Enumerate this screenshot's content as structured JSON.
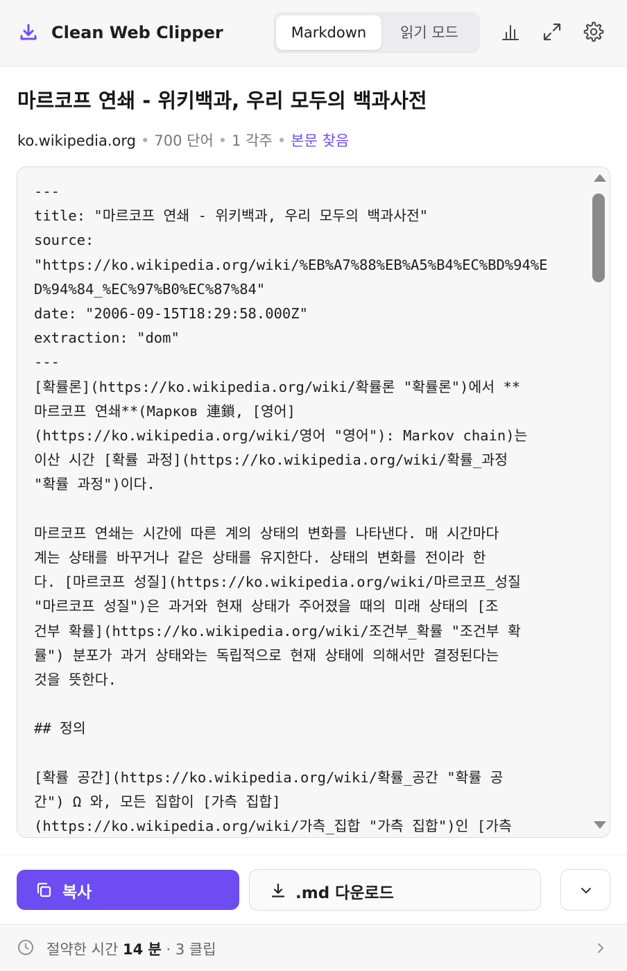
{
  "app": {
    "title": "Clean Web Clipper",
    "brand_color": "#6d4df2"
  },
  "header": {
    "tabs": [
      {
        "label": "Markdown",
        "active": true
      },
      {
        "label": "읽기 모드",
        "active": false
      }
    ],
    "icons": [
      "chart-icon",
      "expand-icon",
      "gear-icon"
    ]
  },
  "article": {
    "title": "마르코프 연쇄 - 위키백과, 우리 모두의 백과사전",
    "domain": "ko.wikipedia.org",
    "word_count": "700 단어",
    "footnotes": "1 각주",
    "find_body_link": "본문 찾음"
  },
  "markdown_lines": [
    "---",
    "title: \"마르코프 연쇄 - 위키백과, 우리 모두의 백과사전\"",
    "source:",
    "\"https://ko.wikipedia.org/wiki/%EB%A7%88%EB%A5%B4%EC%BD%94%E",
    "D%94%84_%EC%97%B0%EC%87%84\"",
    "date: \"2006-09-15T18:29:58.000Z\"",
    "extraction: \"dom\"",
    "---",
    "[확률론](https://ko.wikipedia.org/wiki/확률론 \"확률론\")에서 **",
    "마르코프 연쇄**(Марков 連鎖, [영어]",
    "(https://ko.wikipedia.org/wiki/영어 \"영어\"): Markov chain)는",
    "이산 시간 [확률 과정](https://ko.wikipedia.org/wiki/확률_과정",
    "\"확률 과정\")이다.",
    "",
    "마르코프 연쇄는 시간에 따른 계의 상태의 변화를 나타낸다. 매 시간마다",
    "계는 상태를 바꾸거나 같은 상태를 유지한다. 상태의 변화를 전이라 한",
    "다. [마르코프 성질](https://ko.wikipedia.org/wiki/마르코프_성질",
    "\"마르코프 성질\")은 과거와 현재 상태가 주어졌을 때의 미래 상태의 [조",
    "건부 확률](https://ko.wikipedia.org/wiki/조건부_확률 \"조건부 확",
    "률\") 분포가 과거 상태와는 독립적으로 현재 상태에 의해서만 결정된다는",
    "것을 뜻한다.",
    "",
    "## 정의",
    "",
    "[확률 공간](https://ko.wikipedia.org/wiki/확률_공간 \"확률 공",
    "간\") Ω 와, 모든 집합이 [가측 집합]",
    "(https://ko.wikipedia.org/wiki/가측_집합 \"가측 집합\")인 [가측"
  ],
  "actions": {
    "copy_label": "복사",
    "download_label": ".md 다운로드"
  },
  "status": {
    "prefix": "절약한 시간",
    "time_value": "14 분",
    "sep": "·",
    "clips": "3 클립"
  }
}
